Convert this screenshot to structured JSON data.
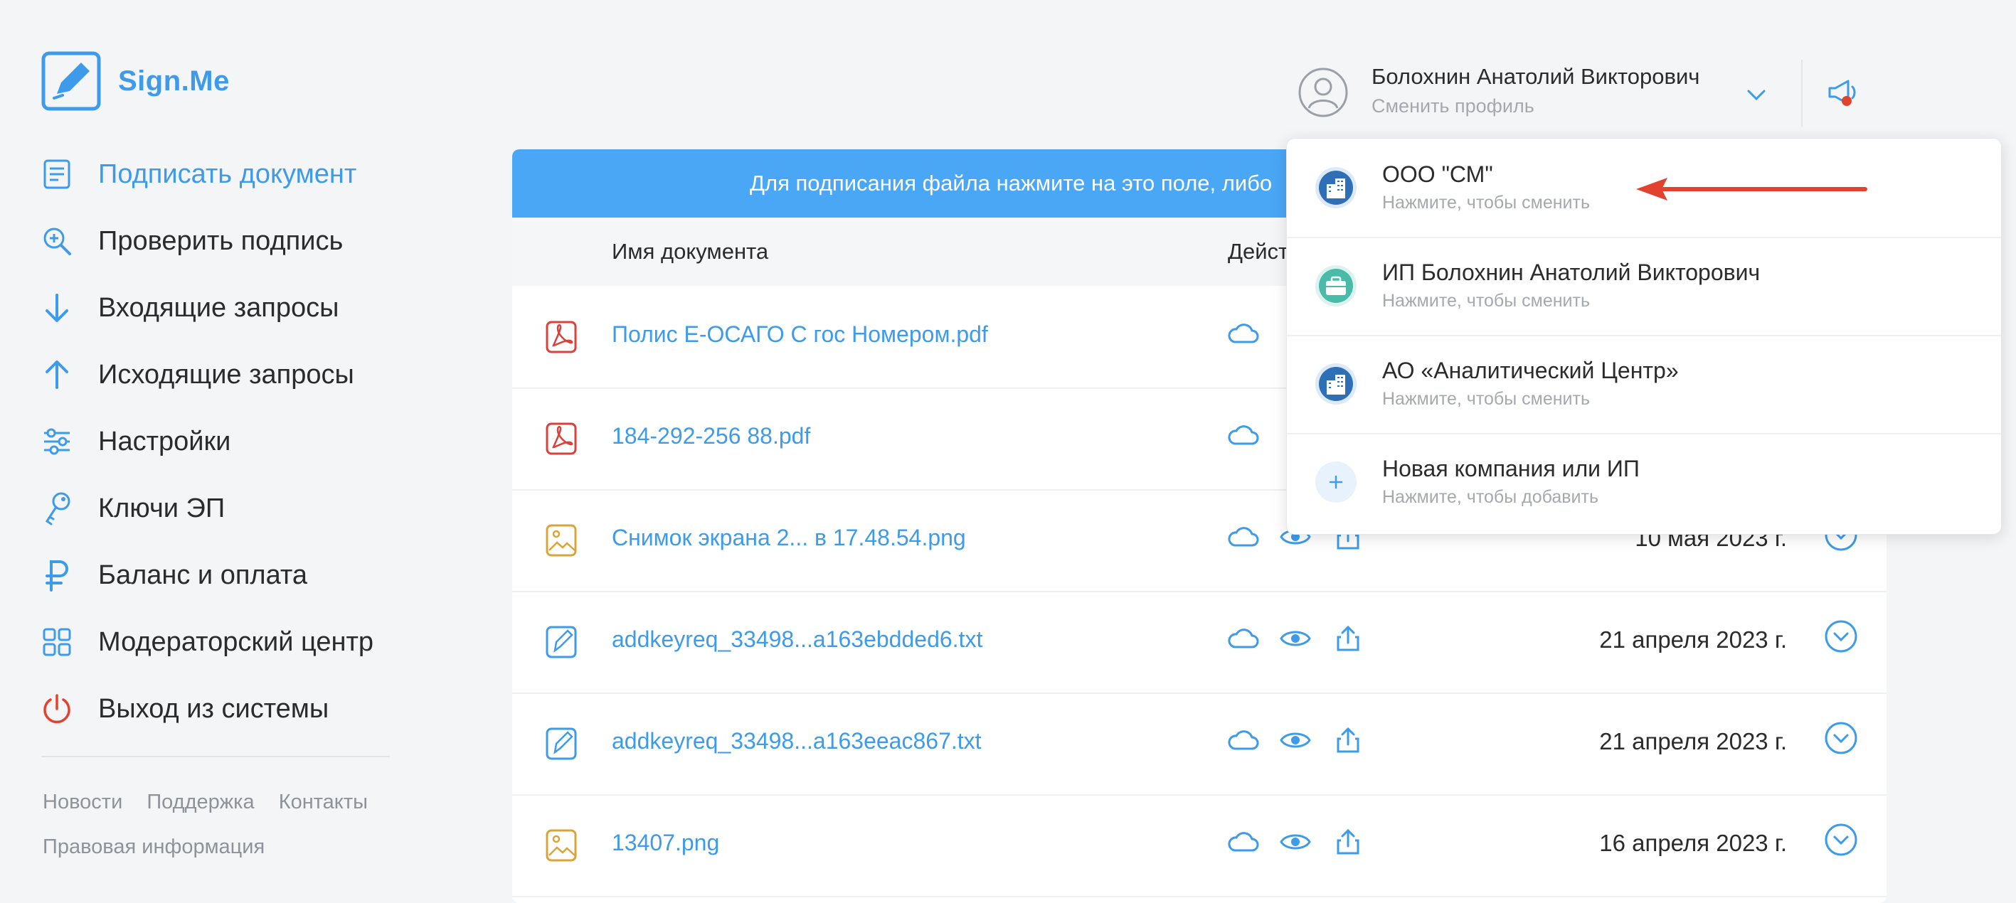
{
  "app": {
    "name": "Sign.Me"
  },
  "sidebar": {
    "items": [
      {
        "label": "Подписать документ",
        "icon": "document-icon",
        "active": true
      },
      {
        "label": "Проверить подпись",
        "icon": "search-check-icon"
      },
      {
        "label": "Входящие запросы",
        "icon": "arrow-down-icon"
      },
      {
        "label": "Исходящие запросы",
        "icon": "arrow-up-icon"
      },
      {
        "label": "Настройки",
        "icon": "sliders-icon"
      },
      {
        "label": "Ключи ЭП",
        "icon": "key-icon"
      },
      {
        "label": "Баланс и оплата",
        "icon": "ruble-icon"
      },
      {
        "label": "Модераторский центр",
        "icon": "grid-icon"
      },
      {
        "label": "Выход из системы",
        "icon": "power-icon"
      }
    ],
    "footer": {
      "news": "Новости",
      "support": "Поддержка",
      "contacts": "Контакты",
      "legal": "Правовая информация"
    }
  },
  "header": {
    "user_name": "Болохнин Анатолий Викторович",
    "change_profile": "Сменить профиль"
  },
  "banner": {
    "text": "Для подписания файла нажмите на это поле, либо"
  },
  "table": {
    "columns": {
      "name": "Имя документа",
      "actions": "Дейст"
    },
    "rows": [
      {
        "name": "Полис Е-ОСАГО С гос Номером.pdf",
        "type": "pdf",
        "date": ""
      },
      {
        "name": "184-292-256 88.pdf",
        "type": "pdf",
        "date": ""
      },
      {
        "name": "Снимок экрана 2... в 17.48.54.png",
        "type": "image",
        "date": "10 мая 2023 г."
      },
      {
        "name": "addkeyreq_33498...a163ebdded6.txt",
        "type": "signed-text",
        "date": "21 апреля 2023 г."
      },
      {
        "name": "addkeyreq_33498...a163eeac867.txt",
        "type": "signed-text",
        "date": "21 апреля 2023 г."
      },
      {
        "name": "13407.png",
        "type": "image",
        "date": "16 апреля 2023 г."
      }
    ]
  },
  "profile_dropdown": {
    "items": [
      {
        "name": "ООО \"СМ\"",
        "sub": "Нажмите, чтобы сменить",
        "icon": "building-icon"
      },
      {
        "name": "ИП Болохнин Анатолий Викторович",
        "sub": "Нажмите, чтобы сменить",
        "icon": "briefcase-icon"
      },
      {
        "name": "АО «Аналитический Центр»",
        "sub": "Нажмите, чтобы сменить",
        "icon": "building-icon"
      },
      {
        "name": "Новая компания или ИП",
        "sub": "Нажмите, чтобы добавить",
        "icon": "plus-icon"
      }
    ]
  },
  "colors": {
    "accent": "#3d9be9",
    "banner": "#4aa7f5",
    "annotation_arrow": "#e2432f",
    "pdf_icon": "#d9413a",
    "image_icon": "#d9a53a"
  }
}
